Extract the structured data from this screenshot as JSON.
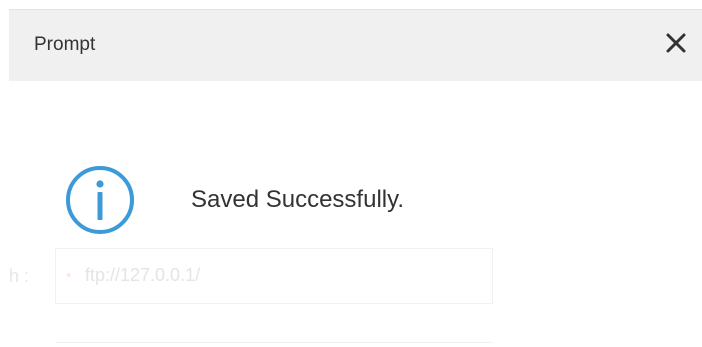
{
  "dialog": {
    "title": "Prompt",
    "close_icon": "close-icon",
    "message_icon": "info-icon",
    "message": "Saved Successfully.",
    "accent_color": "#3d9ad8"
  },
  "background_form": {
    "field_label": "h :",
    "required_mark": "*",
    "field_value": "ftp://127.0.0.1/"
  }
}
